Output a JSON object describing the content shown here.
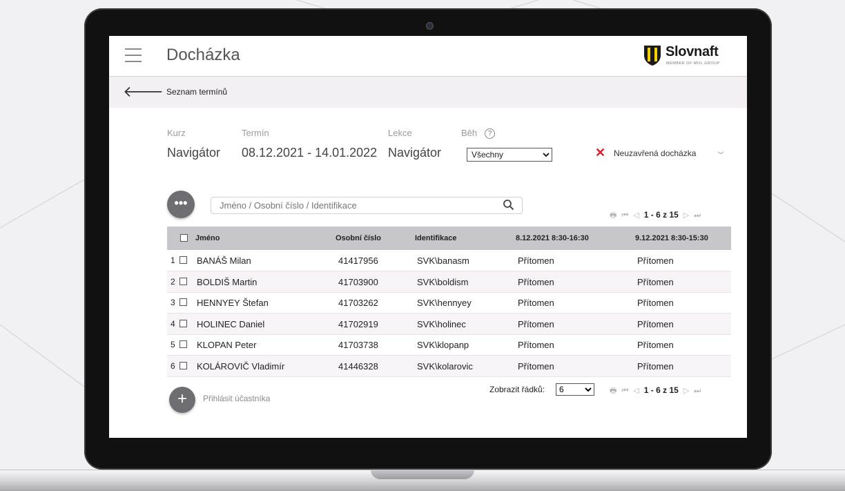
{
  "app": {
    "title": "Docházka"
  },
  "brand": {
    "name": "Slovnaft",
    "tagline": "MEMBER OF MOL GROUP",
    "colors": {
      "yellow": "#f5d000",
      "dark": "#1a1a1a"
    }
  },
  "subbar": {
    "title": "Seznam termínů"
  },
  "filters": {
    "kurz_label": "Kurz",
    "kurz_value": "Navigátor",
    "termin_label": "Termín",
    "termin_value": "08.12.2021 - 14.01.2022",
    "lekce_label": "Lekce",
    "lekce_value": "Navigátor",
    "beh_label": "Běh",
    "beh_help": "?",
    "beh_selected": "Všechny"
  },
  "status": {
    "icon": "close-icon",
    "text": "Neuzavřená docházka",
    "color": "#e01b24"
  },
  "search": {
    "placeholder": "Jméno / Osobní číslo / Identifikace",
    "more_label": "•••"
  },
  "pager": {
    "range": "1 - 6 z 15"
  },
  "table": {
    "columns": [
      "Jméno",
      "Osobní číslo",
      "Identifikace",
      "8.12.2021 8:30-16:30",
      "9.12.2021 8:30-15:30"
    ],
    "rows": [
      {
        "n": "1",
        "name": "BANÁŠ Milan",
        "id": "41417956",
        "login": "SVK\\banasm",
        "d1": "Přítomen",
        "d2": "Přítomen"
      },
      {
        "n": "2",
        "name": "BOLDIŠ Martin",
        "id": "41703900",
        "login": "SVK\\boldism",
        "d1": "Přítomen",
        "d2": "Přítomen"
      },
      {
        "n": "3",
        "name": "HENNYEY Štefan",
        "id": "41703262",
        "login": "SVK\\hennyey",
        "d1": "Přítomen",
        "d2": "Přítomen"
      },
      {
        "n": "4",
        "name": "HOLINEC Daniel",
        "id": "41702919",
        "login": "SVK\\holinec",
        "d1": "Přítomen",
        "d2": "Přítomen"
      },
      {
        "n": "5",
        "name": "KLOPAN Peter",
        "id": "41703738",
        "login": "SVK\\klopanp",
        "d1": "Přítomen",
        "d2": "Přítomen"
      },
      {
        "n": "6",
        "name": "KOLÁROVIČ Vladimír",
        "id": "41446328",
        "login": "SVK\\kolarovic",
        "d1": "Přítomen",
        "d2": "Přítomen"
      }
    ]
  },
  "footer": {
    "add_label": "Přihlásit účastníka",
    "add_symbol": "+",
    "rows_label": "Zobrazit řádků:",
    "rows_selected": "6"
  }
}
